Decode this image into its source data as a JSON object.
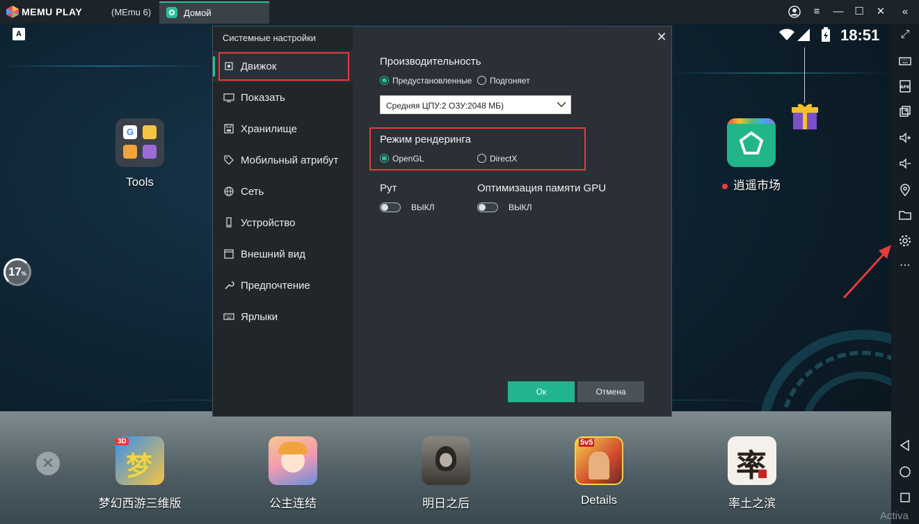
{
  "window": {
    "app_name": "MEMU PLAY",
    "instance": "(MEmu 6)",
    "tab_label": "Домой",
    "watermark": "Activa"
  },
  "status_bar": {
    "clock": "18:51",
    "a_badge": "A"
  },
  "desktop": {
    "tools_label": "Tools",
    "store_label": "逍遥市场",
    "progress_percent": "17"
  },
  "dock": {
    "apps": [
      {
        "label": "梦幻西游三维版"
      },
      {
        "label": "公主连结"
      },
      {
        "label": "明日之后"
      },
      {
        "label": "Details"
      },
      {
        "label": "率土之滨"
      }
    ]
  },
  "dialog": {
    "title": "Системные настройки",
    "nav": [
      {
        "label": "Движок",
        "icon": "chip-icon"
      },
      {
        "label": "Показать",
        "icon": "monitor-icon"
      },
      {
        "label": "Хранилище",
        "icon": "storage-icon"
      },
      {
        "label": "Мобильный атрибут",
        "icon": "tag-icon"
      },
      {
        "label": "Сеть",
        "icon": "globe-icon"
      },
      {
        "label": "Устройство",
        "icon": "phone-icon"
      },
      {
        "label": "Внешний вид",
        "icon": "window-icon"
      },
      {
        "label": "Предпочтение",
        "icon": "wrench-icon"
      },
      {
        "label": "Ярлыки",
        "icon": "keyboard-icon"
      }
    ],
    "performance": {
      "title": "Производительность",
      "opt_preset": "Предустановленные",
      "opt_custom": "Подгоняет",
      "selected": "Средняя ЦПУ:2 ОЗУ:2048 МБ)"
    },
    "render": {
      "title": "Режим рендеринга",
      "opt_opengl": "OpenGL",
      "opt_directx": "DirectX"
    },
    "root": {
      "title": "Рут",
      "state": "ВЫКЛ"
    },
    "gpu_mem": {
      "title": "Оптимизация памяти GPU",
      "state": "ВЫКЛ"
    },
    "ok_label": "Ок",
    "cancel_label": "Отмена"
  },
  "colors": {
    "accent": "#2bbf9b",
    "highlight": "#e53c3c"
  }
}
